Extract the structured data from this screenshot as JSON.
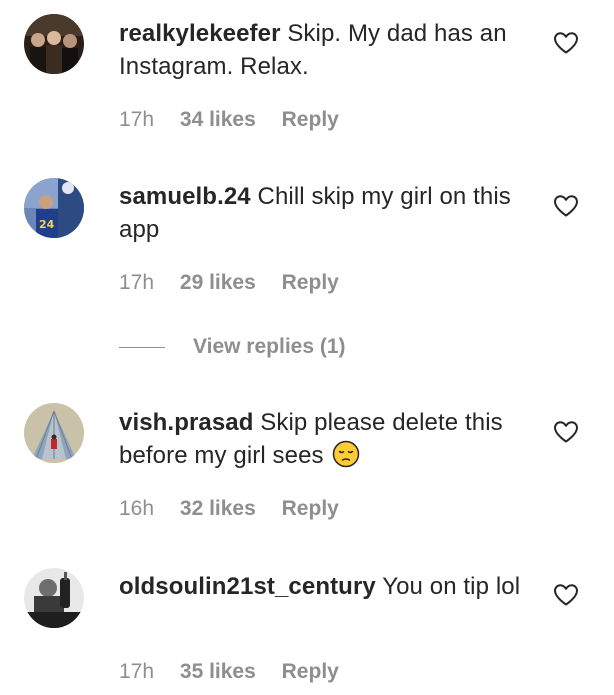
{
  "comments": [
    {
      "username": "realkylekeefer",
      "text": "Skip. My dad has an Instagram. Relax.",
      "time": "17h",
      "likes": "34 likes",
      "reply": "Reply"
    },
    {
      "username": "samuelb.24",
      "text": "Chill skip my girl on this app",
      "time": "17h",
      "likes": "29 likes",
      "reply": "Reply",
      "view_replies": "View replies (1)"
    },
    {
      "username": "vish.prasad",
      "text": "Skip please delete this before my girl sees",
      "emoji": "pensive-face-emoji",
      "time": "16h",
      "likes": "32 likes",
      "reply": "Reply"
    },
    {
      "username": "oldsoulin21st_century",
      "text": "You on tip lol",
      "time": "17h",
      "likes": "35 likes",
      "reply": "Reply"
    }
  ],
  "colors": {
    "text": "#262626",
    "secondary": "#8e8e8e",
    "background": "#ffffff"
  },
  "icons": {
    "like": "heart-outline-icon"
  }
}
